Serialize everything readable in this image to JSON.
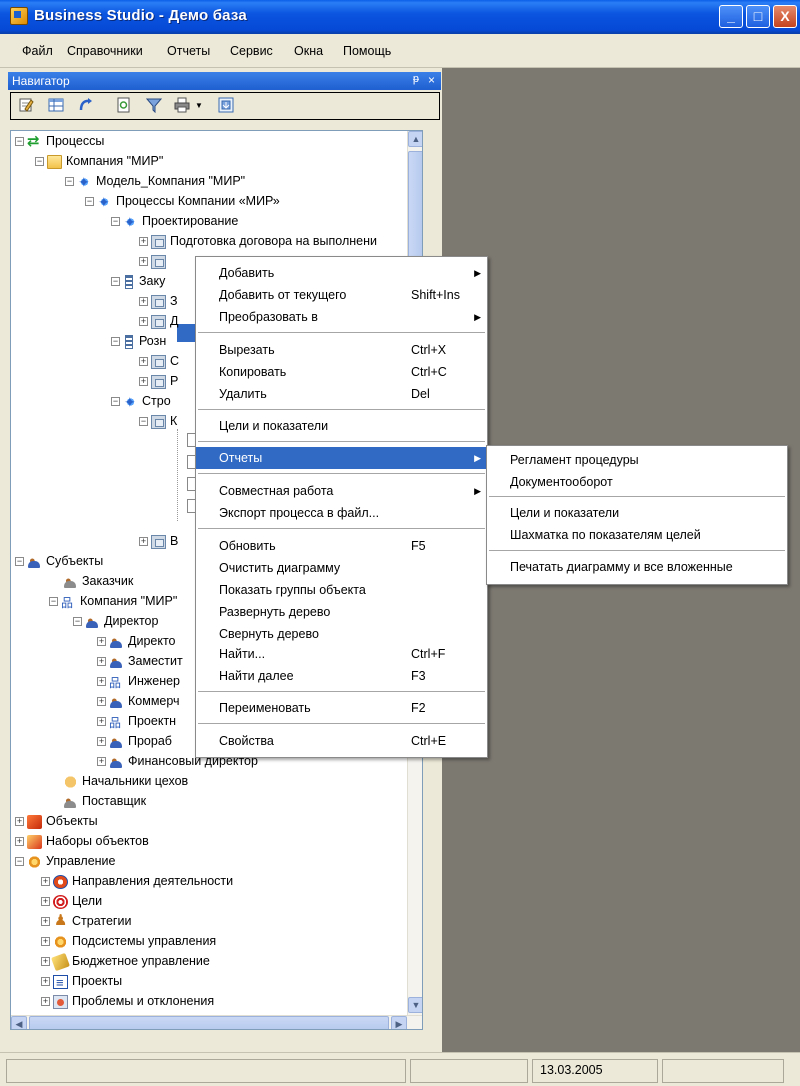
{
  "window": {
    "title": "Business Studio - Демо база",
    "minimize": "_",
    "maximize": "□",
    "close": "X"
  },
  "menubar": [
    "Файл",
    "Справочники",
    "Отчеты",
    "Сервис",
    "Окна",
    "Помощь"
  ],
  "navigator": {
    "title": "Навигатор",
    "pin": "ᵽ",
    "close": "×",
    "toolbar_icons": [
      "edit-icon",
      "table-icon",
      "refresh-icon",
      "document-icon",
      "filter-icon",
      "print-icon",
      "export-icon"
    ]
  },
  "tree": {
    "processes": "Процессы",
    "company": "Компания \"МИР\"",
    "model": "Модель_Компания \"МИР\"",
    "company_processes": "Процессы Компании «МИР»",
    "design": "Проектирование",
    "contract_prep": "Подготовка договора на выполнени",
    "selected_item": "Р",
    "procurement": "Заку",
    "proc_1": "З",
    "proc_2": "Д",
    "retail": "Розн",
    "retail_1": "С",
    "retail_2": "Р",
    "construction": "Стро",
    "constr_1": "К",
    "constr_2": "В",
    "subjects": "Субъекты",
    "customer": "Заказчик",
    "subj_company": "Компания \"МИР\"",
    "director": "Директор",
    "director_sub": "Директо",
    "deputy": "Заместит",
    "engineer": "Инженер",
    "commercial": "Коммерч",
    "design_dept": "Проектн",
    "foreman": "Прораб",
    "finance_director": "Финансовый директор",
    "workshop_heads": "Начальники цехов",
    "supplier": "Поставщик",
    "objects": "Объекты",
    "object_sets": "Наборы объектов",
    "management": "Управление",
    "activity_directions": "Направления деятельности",
    "goals": "Цели",
    "strategies": "Стратегии",
    "mgmt_subsystems": "Подсистемы управления",
    "budget": "Бюджетное управление",
    "projects": "Проекты",
    "problems": "Проблемы и отклонения"
  },
  "context_menu": {
    "add": "Добавить",
    "add_from_current": "Добавить от текущего",
    "add_from_current_sc": "Shift+Ins",
    "convert_to": "Преобразовать в",
    "cut": "Вырезать",
    "cut_sc": "Ctrl+X",
    "copy": "Копировать",
    "copy_sc": "Ctrl+C",
    "delete": "Удалить",
    "delete_sc": "Del",
    "goals_indicators": "Цели и показатели",
    "reports": "Отчеты",
    "collaboration": "Совместная работа",
    "export_process": "Экспорт процесса в файл...",
    "refresh": "Обновить",
    "refresh_sc": "F5",
    "clear_diagram": "Очистить диаграмму",
    "show_groups": "Показать группы объекта",
    "expand_tree": "Развернуть дерево",
    "collapse_tree": "Свернуть дерево",
    "find": "Найти...",
    "find_sc": "Ctrl+F",
    "find_next": "Найти далее",
    "find_next_sc": "F3",
    "rename": "Переименовать",
    "rename_sc": "F2",
    "properties": "Свойства",
    "properties_sc": "Ctrl+E"
  },
  "submenu": {
    "procedure_regulation": "Регламент процедуры",
    "document_flow": "Документооборот",
    "goals_indicators": "Цели и показатели",
    "goals_chessboard": "Шахматка по показателям целей",
    "print_diagram_all": "Печатать диаграмму и все вложенные"
  },
  "statusbar": {
    "date": "13.03.2005"
  }
}
